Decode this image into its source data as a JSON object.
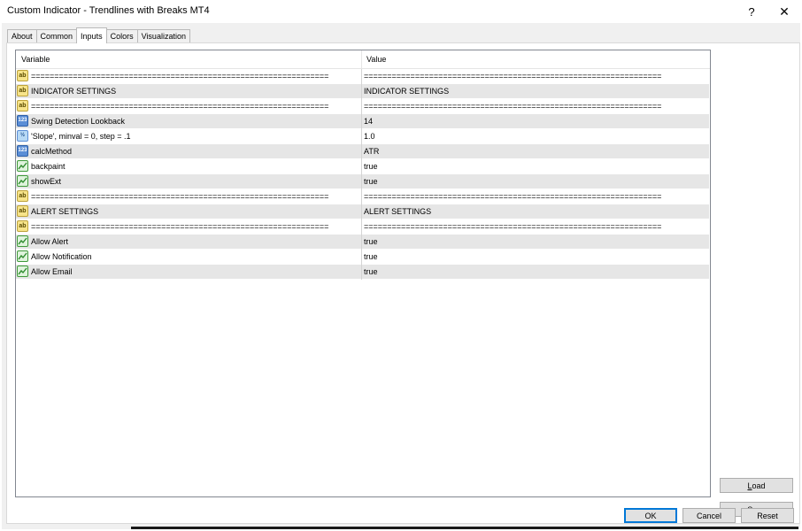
{
  "window": {
    "title": "Custom Indicator - Trendlines with Breaks MT4",
    "help": "?",
    "close": "✕"
  },
  "tabs": [
    {
      "label": "About",
      "active": false
    },
    {
      "label": "Common",
      "active": false
    },
    {
      "label": "Inputs",
      "active": true
    },
    {
      "label": "Colors",
      "active": false
    },
    {
      "label": "Visualization",
      "active": false
    }
  ],
  "grid": {
    "columns": [
      "Variable",
      "Value"
    ],
    "rows": [
      {
        "icon": "string-icon",
        "variable": "================================================================",
        "value": "================================================================"
      },
      {
        "icon": "string-icon",
        "variable": "INDICATOR SETTINGS",
        "value": "INDICATOR SETTINGS"
      },
      {
        "icon": "string-icon",
        "variable": "================================================================",
        "value": "================================================================"
      },
      {
        "icon": "integer-icon",
        "variable": "Swing Detection Lookback",
        "value": "14"
      },
      {
        "icon": "double-icon",
        "variable": "'Slope', minval = 0, step = .1",
        "value": "1.0"
      },
      {
        "icon": "integer-icon",
        "variable": "calcMethod",
        "value": "ATR"
      },
      {
        "icon": "bool-icon",
        "variable": "backpaint",
        "value": "true"
      },
      {
        "icon": "bool-icon",
        "variable": "showExt",
        "value": "true"
      },
      {
        "icon": "string-icon",
        "variable": "================================================================",
        "value": "================================================================"
      },
      {
        "icon": "string-icon",
        "variable": "ALERT SETTINGS",
        "value": "ALERT SETTINGS"
      },
      {
        "icon": "string-icon",
        "variable": "================================================================",
        "value": "================================================================"
      },
      {
        "icon": "bool-icon",
        "variable": "Allow Alert",
        "value": "true"
      },
      {
        "icon": "bool-icon",
        "variable": "Allow Notification",
        "value": "true"
      },
      {
        "icon": "bool-icon",
        "variable": "Allow Email",
        "value": "true"
      }
    ]
  },
  "buttons": {
    "load": "Load",
    "load_hotkey": "L",
    "save": "Save",
    "save_hotkey": "S",
    "ok": "OK",
    "cancel": "Cancel",
    "reset": "Reset"
  },
  "colors": {
    "row_alt": "#e6e6e6",
    "ok_border": "#0078d7"
  }
}
